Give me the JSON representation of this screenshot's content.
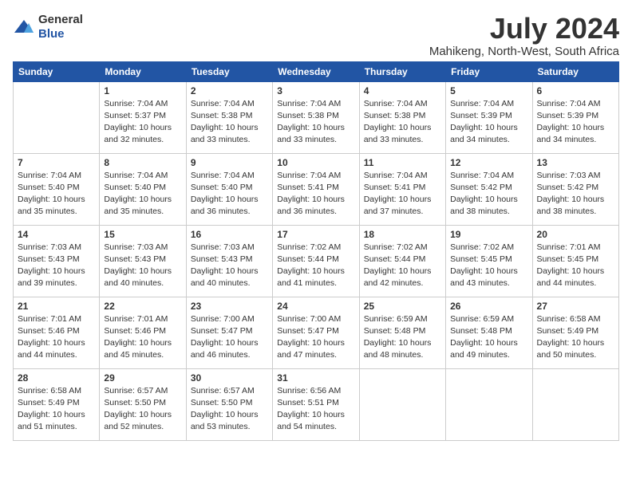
{
  "logo": {
    "general": "General",
    "blue": "Blue"
  },
  "title": "July 2024",
  "subtitle": "Mahikeng, North-West, South Africa",
  "weekdays": [
    "Sunday",
    "Monday",
    "Tuesday",
    "Wednesday",
    "Thursday",
    "Friday",
    "Saturday"
  ],
  "weeks": [
    [
      {
        "day": "",
        "sunrise": "",
        "sunset": "",
        "daylight": ""
      },
      {
        "day": "1",
        "sunrise": "Sunrise: 7:04 AM",
        "sunset": "Sunset: 5:37 PM",
        "daylight": "Daylight: 10 hours and 32 minutes."
      },
      {
        "day": "2",
        "sunrise": "Sunrise: 7:04 AM",
        "sunset": "Sunset: 5:38 PM",
        "daylight": "Daylight: 10 hours and 33 minutes."
      },
      {
        "day": "3",
        "sunrise": "Sunrise: 7:04 AM",
        "sunset": "Sunset: 5:38 PM",
        "daylight": "Daylight: 10 hours and 33 minutes."
      },
      {
        "day": "4",
        "sunrise": "Sunrise: 7:04 AM",
        "sunset": "Sunset: 5:38 PM",
        "daylight": "Daylight: 10 hours and 33 minutes."
      },
      {
        "day": "5",
        "sunrise": "Sunrise: 7:04 AM",
        "sunset": "Sunset: 5:39 PM",
        "daylight": "Daylight: 10 hours and 34 minutes."
      },
      {
        "day": "6",
        "sunrise": "Sunrise: 7:04 AM",
        "sunset": "Sunset: 5:39 PM",
        "daylight": "Daylight: 10 hours and 34 minutes."
      }
    ],
    [
      {
        "day": "7",
        "sunrise": "Sunrise: 7:04 AM",
        "sunset": "Sunset: 5:40 PM",
        "daylight": "Daylight: 10 hours and 35 minutes."
      },
      {
        "day": "8",
        "sunrise": "Sunrise: 7:04 AM",
        "sunset": "Sunset: 5:40 PM",
        "daylight": "Daylight: 10 hours and 35 minutes."
      },
      {
        "day": "9",
        "sunrise": "Sunrise: 7:04 AM",
        "sunset": "Sunset: 5:40 PM",
        "daylight": "Daylight: 10 hours and 36 minutes."
      },
      {
        "day": "10",
        "sunrise": "Sunrise: 7:04 AM",
        "sunset": "Sunset: 5:41 PM",
        "daylight": "Daylight: 10 hours and 36 minutes."
      },
      {
        "day": "11",
        "sunrise": "Sunrise: 7:04 AM",
        "sunset": "Sunset: 5:41 PM",
        "daylight": "Daylight: 10 hours and 37 minutes."
      },
      {
        "day": "12",
        "sunrise": "Sunrise: 7:04 AM",
        "sunset": "Sunset: 5:42 PM",
        "daylight": "Daylight: 10 hours and 38 minutes."
      },
      {
        "day": "13",
        "sunrise": "Sunrise: 7:03 AM",
        "sunset": "Sunset: 5:42 PM",
        "daylight": "Daylight: 10 hours and 38 minutes."
      }
    ],
    [
      {
        "day": "14",
        "sunrise": "Sunrise: 7:03 AM",
        "sunset": "Sunset: 5:43 PM",
        "daylight": "Daylight: 10 hours and 39 minutes."
      },
      {
        "day": "15",
        "sunrise": "Sunrise: 7:03 AM",
        "sunset": "Sunset: 5:43 PM",
        "daylight": "Daylight: 10 hours and 40 minutes."
      },
      {
        "day": "16",
        "sunrise": "Sunrise: 7:03 AM",
        "sunset": "Sunset: 5:43 PM",
        "daylight": "Daylight: 10 hours and 40 minutes."
      },
      {
        "day": "17",
        "sunrise": "Sunrise: 7:02 AM",
        "sunset": "Sunset: 5:44 PM",
        "daylight": "Daylight: 10 hours and 41 minutes."
      },
      {
        "day": "18",
        "sunrise": "Sunrise: 7:02 AM",
        "sunset": "Sunset: 5:44 PM",
        "daylight": "Daylight: 10 hours and 42 minutes."
      },
      {
        "day": "19",
        "sunrise": "Sunrise: 7:02 AM",
        "sunset": "Sunset: 5:45 PM",
        "daylight": "Daylight: 10 hours and 43 minutes."
      },
      {
        "day": "20",
        "sunrise": "Sunrise: 7:01 AM",
        "sunset": "Sunset: 5:45 PM",
        "daylight": "Daylight: 10 hours and 44 minutes."
      }
    ],
    [
      {
        "day": "21",
        "sunrise": "Sunrise: 7:01 AM",
        "sunset": "Sunset: 5:46 PM",
        "daylight": "Daylight: 10 hours and 44 minutes."
      },
      {
        "day": "22",
        "sunrise": "Sunrise: 7:01 AM",
        "sunset": "Sunset: 5:46 PM",
        "daylight": "Daylight: 10 hours and 45 minutes."
      },
      {
        "day": "23",
        "sunrise": "Sunrise: 7:00 AM",
        "sunset": "Sunset: 5:47 PM",
        "daylight": "Daylight: 10 hours and 46 minutes."
      },
      {
        "day": "24",
        "sunrise": "Sunrise: 7:00 AM",
        "sunset": "Sunset: 5:47 PM",
        "daylight": "Daylight: 10 hours and 47 minutes."
      },
      {
        "day": "25",
        "sunrise": "Sunrise: 6:59 AM",
        "sunset": "Sunset: 5:48 PM",
        "daylight": "Daylight: 10 hours and 48 minutes."
      },
      {
        "day": "26",
        "sunrise": "Sunrise: 6:59 AM",
        "sunset": "Sunset: 5:48 PM",
        "daylight": "Daylight: 10 hours and 49 minutes."
      },
      {
        "day": "27",
        "sunrise": "Sunrise: 6:58 AM",
        "sunset": "Sunset: 5:49 PM",
        "daylight": "Daylight: 10 hours and 50 minutes."
      }
    ],
    [
      {
        "day": "28",
        "sunrise": "Sunrise: 6:58 AM",
        "sunset": "Sunset: 5:49 PM",
        "daylight": "Daylight: 10 hours and 51 minutes."
      },
      {
        "day": "29",
        "sunrise": "Sunrise: 6:57 AM",
        "sunset": "Sunset: 5:50 PM",
        "daylight": "Daylight: 10 hours and 52 minutes."
      },
      {
        "day": "30",
        "sunrise": "Sunrise: 6:57 AM",
        "sunset": "Sunset: 5:50 PM",
        "daylight": "Daylight: 10 hours and 53 minutes."
      },
      {
        "day": "31",
        "sunrise": "Sunrise: 6:56 AM",
        "sunset": "Sunset: 5:51 PM",
        "daylight": "Daylight: 10 hours and 54 minutes."
      },
      {
        "day": "",
        "sunrise": "",
        "sunset": "",
        "daylight": ""
      },
      {
        "day": "",
        "sunrise": "",
        "sunset": "",
        "daylight": ""
      },
      {
        "day": "",
        "sunrise": "",
        "sunset": "",
        "daylight": ""
      }
    ]
  ]
}
